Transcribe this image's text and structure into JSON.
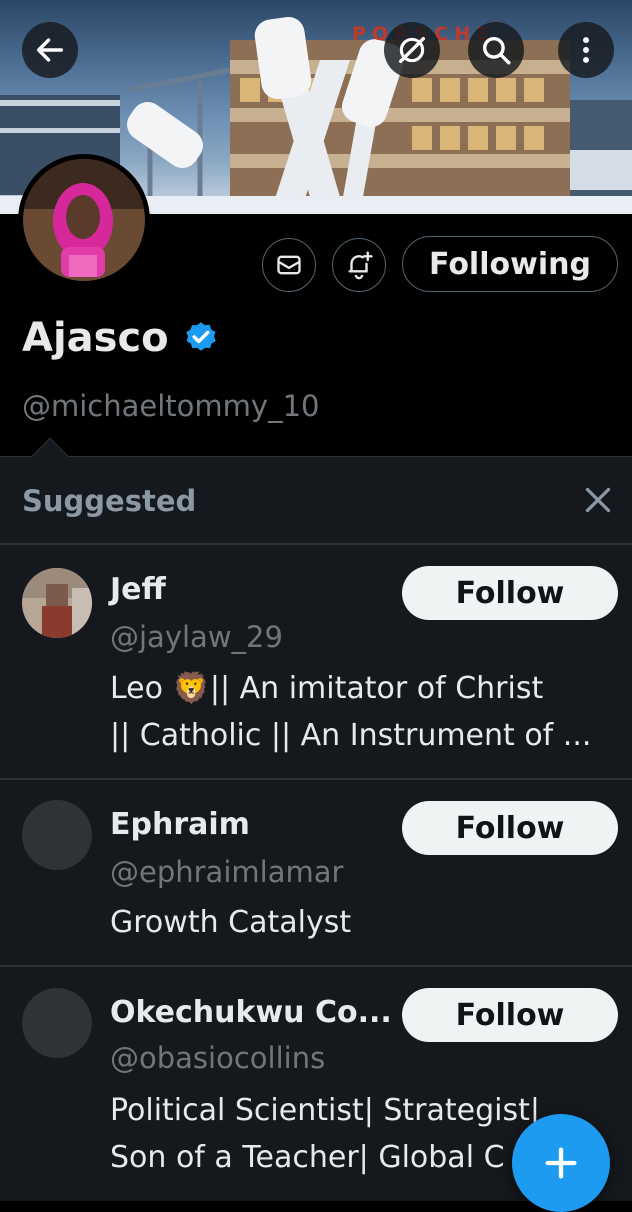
{
  "profile": {
    "display_name": "Ajasco",
    "handle": "@michaeltommy_10",
    "verified": true,
    "following_label": "Following",
    "banner_sign_text": "PORSCHE"
  },
  "icons": {
    "back": "arrow-left-icon",
    "grok": "grok-icon",
    "search": "search-icon",
    "more": "more-vertical-icon",
    "message": "mail-icon",
    "notify": "bell-plus-icon",
    "verified": "verified-badge-icon",
    "close": "close-icon",
    "compose": "plus-icon"
  },
  "suggested": {
    "title": "Suggested",
    "items": [
      {
        "name": "Jeff",
        "handle": "@jaylaw_29",
        "bio_line1": "Leo 🦁|| An imitator of Christ",
        "bio_line2": "|| Catholic || An Instrument of ...",
        "follow_label": "Follow"
      },
      {
        "name": "Ephraim",
        "handle": "@ephraimlamar",
        "bio_line1": "Growth Catalyst",
        "follow_label": "Follow"
      },
      {
        "name": "Okechukwu Co...",
        "handle": "@obasiocollins",
        "bio_line1": "Political Scientist| Strategist|",
        "bio_line2": "Son of a Teacher| Global C",
        "follow_label": "Follow"
      }
    ]
  },
  "colors": {
    "accent": "#1d9bf0",
    "background": "#000000",
    "panel": "#15181c",
    "secondary_text": "#71767b"
  }
}
